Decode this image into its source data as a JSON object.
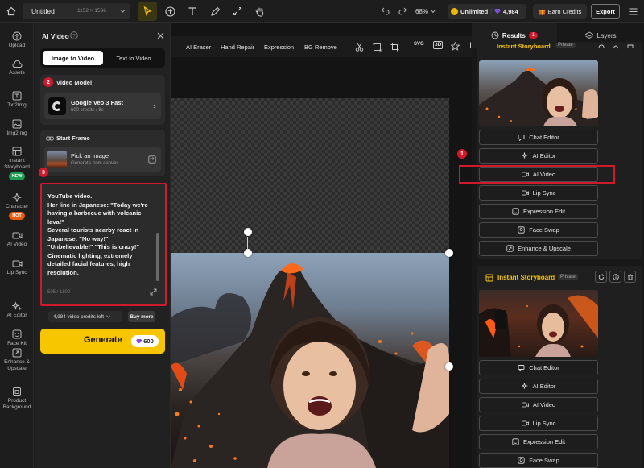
{
  "topbar": {
    "doc_title": "Untitled",
    "canvas_size": "1152 × 1536",
    "zoom": "68%",
    "plan": "Unlimited",
    "credits": "4,984",
    "earn_credits": "Earn Credits",
    "export": "Export"
  },
  "nav": [
    {
      "label": "Upload",
      "icon": "upload-icon"
    },
    {
      "label": "Assets",
      "icon": "cloud-icon"
    },
    {
      "label": "Txt2Img",
      "icon": "text-image-icon"
    },
    {
      "label": "Img2Img",
      "icon": "image-icon"
    },
    {
      "label": "Instant Storyboard",
      "icon": "storyboard-icon",
      "badge": "NEW"
    },
    {
      "label": "Character",
      "icon": "character-icon",
      "badge": "HOT"
    },
    {
      "label": "AI Video",
      "icon": "video-icon"
    },
    {
      "label": "Lip Sync",
      "icon": "lipsync-icon"
    },
    {
      "label": "AI Editor",
      "icon": "sparkle-icon"
    },
    {
      "label": "Face Kit",
      "icon": "face-icon"
    },
    {
      "label": "Enhance & Upscale",
      "icon": "enhance-icon"
    },
    {
      "label": "Product Background",
      "icon": "product-icon"
    }
  ],
  "panel": {
    "title": "AI Video",
    "tabs": [
      "Image to Video",
      "Text to Video"
    ],
    "step2": "2",
    "video_model_label": "Video Model",
    "model_name": "Google Veo 3 Fast",
    "model_sub": "600 credits / 8s",
    "start_frame_label": "Start Frame",
    "pick_image": "Pick an image",
    "pick_sub": "Generate from canvas",
    "step3": "3",
    "prompt_lines": [
      "YouTube video.",
      "Her line in Japanese: \"Today we're",
      "having a barbecue with volcanic",
      "lava!\"",
      "Several tourists nearby react in",
      "Japanese: \"No way!\"",
      "\"Unbelievable!\" \"This is crazy!\"",
      "Cinematic lighting, extremely",
      "detailed facial features, high",
      "resolution."
    ],
    "char_count": "505 / 1800",
    "credits_left": "4,984 video credits left",
    "buy_more": "Buy more",
    "generate": "Generate",
    "generate_cost": "600"
  },
  "canvas_toolbar": [
    "AI Eraser",
    "Hand Repair",
    "Expression",
    "BG Remove"
  ],
  "right": {
    "results_tab": "Results",
    "results_count": "1",
    "layers_tab": "Layers",
    "step1": "1",
    "card_title": "Instant Storyboard",
    "card_privacy": "Private",
    "actions1": [
      "Chat Editor",
      "AI Editor",
      "AI Video",
      "Lip Sync",
      "Expression Edit",
      "Face Swap",
      "Enhance & Upscale"
    ],
    "actions2": [
      "Chat Editor",
      "AI Editor",
      "AI Video",
      "Lip Sync",
      "Expression Edit",
      "Face Swap"
    ]
  },
  "colors": {
    "accent_yellow": "#f7c600",
    "highlight_red": "#d1192c",
    "purple": "#7b4fe0"
  }
}
